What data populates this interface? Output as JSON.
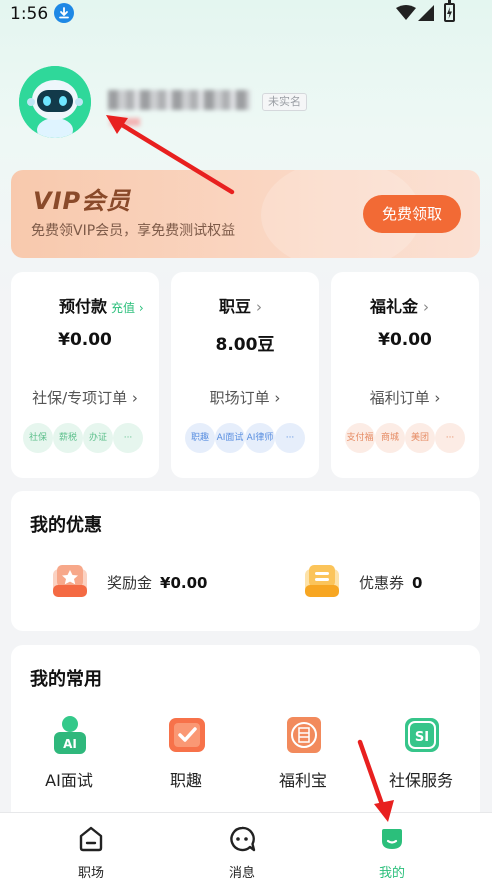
{
  "status_bar": {
    "time": "1:56"
  },
  "profile": {
    "verify_badge": "未实名"
  },
  "vip": {
    "title": "VIP会员",
    "subtitle": "免费领VIP会员，享免费测试权益",
    "button": "免费领取"
  },
  "cards": [
    {
      "title": "预付款",
      "link": "充值",
      "value": "¥0.00",
      "order": "社保/专项订单",
      "chips": [
        "社保",
        "薪税",
        "办证",
        "···"
      ],
      "chip_color": "green"
    },
    {
      "title": "职豆",
      "value": "8.00豆",
      "order": "职场订单",
      "chips": [
        "职趣",
        "AI面试",
        "AI律师",
        "···"
      ],
      "chip_color": "blue"
    },
    {
      "title": "福礼金",
      "value": "¥0.00",
      "order": "福利订单",
      "chips": [
        "支付福",
        "商城",
        "美团",
        "···"
      ],
      "chip_color": "orange"
    }
  ],
  "offers": {
    "title": "我的优惠",
    "items": [
      {
        "label": "奖励金",
        "value": "¥0.00",
        "icon": "reward-icon"
      },
      {
        "label": "优惠券",
        "value": "0",
        "icon": "coupon-icon"
      }
    ]
  },
  "common": {
    "title": "我的常用",
    "items": [
      {
        "label": "AI面试",
        "icon": "ai-interview-icon"
      },
      {
        "label": "职趣",
        "icon": "zhiqu-icon"
      },
      {
        "label": "福利宝",
        "icon": "fulibao-icon"
      },
      {
        "label": "社保服务",
        "icon": "social-security-icon"
      }
    ]
  },
  "nav": {
    "items": [
      {
        "label": "职场",
        "icon": "home-icon",
        "active": false
      },
      {
        "label": "消息",
        "icon": "message-icon",
        "active": false
      },
      {
        "label": "我的",
        "icon": "profile-icon",
        "active": true
      }
    ]
  },
  "colors": {
    "accent": "#2bbf7b",
    "vip_button": "#f26a35",
    "annotation": "#e8201f"
  }
}
